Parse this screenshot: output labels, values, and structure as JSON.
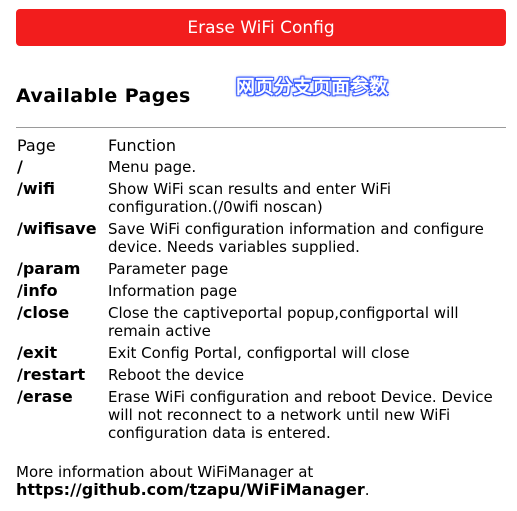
{
  "erase_button": {
    "label": "Erase WiFi Config",
    "color": "#f21d1d"
  },
  "heading": "Available Pages",
  "overlay_label": "网页分支页面参数",
  "table": {
    "headers": [
      "Page",
      "Function"
    ],
    "rows": [
      {
        "path": "/",
        "description": "Menu page."
      },
      {
        "path": "/wifi",
        "description": "Show WiFi scan results and enter WiFi configuration.(/0wifi noscan)"
      },
      {
        "path": "/wifisave",
        "description": "Save WiFi configuration information and configure device. Needs variables supplied."
      },
      {
        "path": "/param",
        "description": "Parameter page"
      },
      {
        "path": "/info",
        "description": "Information page"
      },
      {
        "path": "/close",
        "description": "Close the captiveportal popup,configportal will remain active"
      },
      {
        "path": "/exit",
        "description": "Exit Config Portal, configportal will close"
      },
      {
        "path": "/restart",
        "description": "Reboot the device"
      },
      {
        "path": "/erase",
        "description": "Erase WiFi configuration and reboot Device. Device will not reconnect to a network until new WiFi configuration data is entered."
      }
    ]
  },
  "more_info": {
    "text": "More information about WiFiManager at",
    "link_text": "https://github.com/tzapu/WiFiManager",
    "suffix": "."
  }
}
